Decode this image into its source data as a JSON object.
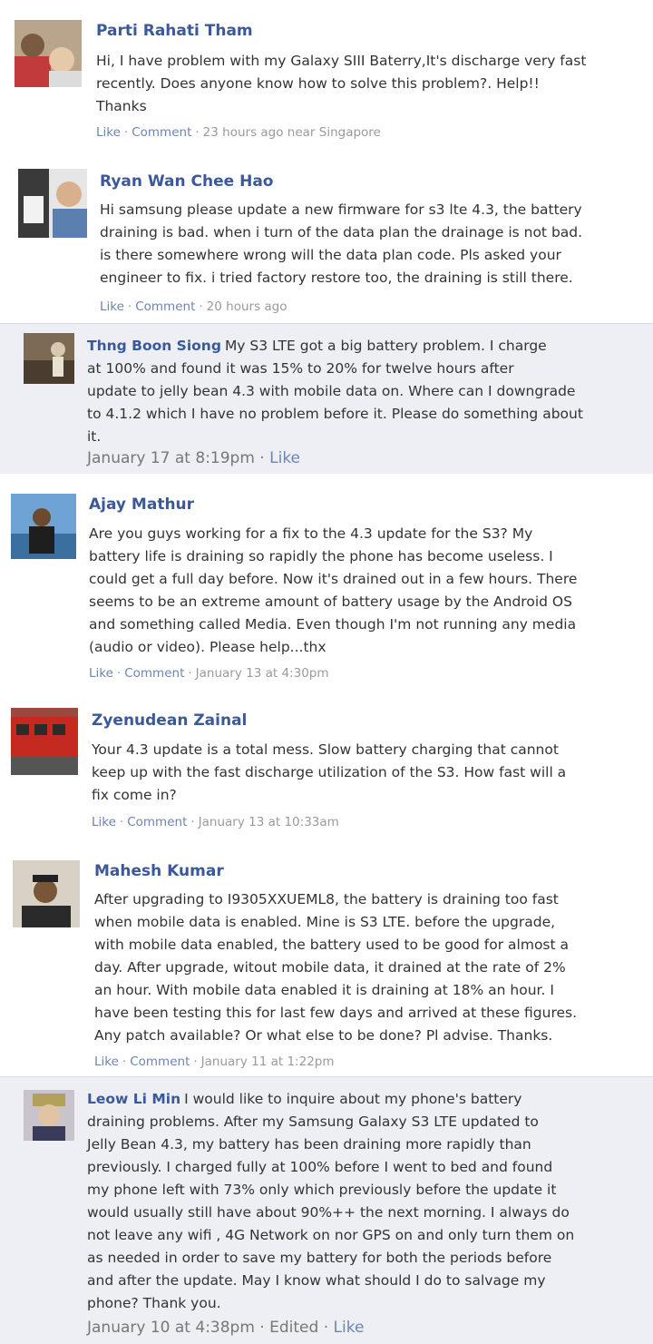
{
  "comments": [
    {
      "author": "Parti Rahati Tham",
      "text": "Hi, I have problem with my Galaxy SIII Baterry,It's discharge very fast\nrecently. Does anyone know how to solve this problem?. Help!!\nThanks",
      "like": "Like",
      "comment": "Comment",
      "time": "23 hours ago near Singapore"
    },
    {
      "author": "Ryan Wan Chee Hao",
      "text": "Hi samsung please update a new firmware for s3 lte 4.3, the battery\ndraining is bad. when i turn of the data plan the drainage is not bad.\nis there somewhere wrong will the data plan code. Pls asked your\nengineer to fix. i tried factory restore too, the draining is still there.",
      "like": "Like",
      "comment": "Comment",
      "time": "20 hours ago"
    },
    {
      "author": "Thng Boon Siong",
      "text": "My S3 LTE got a big battery problem. I charge\nat 100% and found it was 15% to 20% for twelve hours after\nupdate to jelly bean 4.3 with mobile data on. Where can I downgrade\nto 4.1.2 which I have no problem before it. Please do something about\nit.",
      "time": "January 17 at 8:19pm",
      "like": "Like"
    },
    {
      "author": "Ajay Mathur",
      "text": "Are you guys working for a fix to the 4.3 update for the S3? My\nbattery life is draining so rapidly the phone has become useless. I\ncould get a full day before. Now it's drained out in a few hours. There\nseems to be an extreme amount of battery usage by the Android OS\nand something called Media. Even though I'm not running any media\n(audio or video). Please help...thx",
      "like": "Like",
      "comment": "Comment",
      "time": "January 13 at 4:30pm"
    },
    {
      "author": "Zyenudean Zainal",
      "text": "Your 4.3 update is a total mess. Slow battery charging that cannot\nkeep up with the fast discharge utilization of the S3. How fast will a\nfix come in?",
      "like": "Like",
      "comment": "Comment",
      "time": "January 13 at 10:33am"
    },
    {
      "author": "Mahesh Kumar",
      "text": "After upgrading to I9305XXUEML8, the battery is draining too fast\nwhen mobile data is enabled. Mine is S3 LTE. before the upgrade,\nwith mobile data enabled, the battery used to be good for almost a\nday. After upgrade, witout mobile data, it drained at the rate of 2%\nan hour. With mobile data enabled it is draining at 18% an hour. I\nhave been testing this for last few days and arrived at these figures.\nAny patch available? Or what else to be done? Pl advise. Thanks.",
      "like": "Like",
      "comment": "Comment",
      "time": "January 11 at 1:22pm"
    },
    {
      "author": "Leow Li Min",
      "text": "I would like to inquire about my phone's battery\ndraining problems. After my Samsung Galaxy S3 LTE updated to\nJelly Bean 4.3, my battery has been draining more rapidly than\npreviously. I charged fully at 100% before I went to bed and found\nmy phone left with 73% only which previously before the update it\nwould usually still have about 90%++ the next morning. I always do\nnot leave any wifi , 4G Network on nor GPS on and only turn them on\nas needed in order to save my battery for both the periods before\nand after the update. May I know what should I do to salvage my\nphone? Thank you.",
      "time": "January 10 at 4:38pm",
      "edited": "Edited",
      "like": "Like"
    }
  ]
}
